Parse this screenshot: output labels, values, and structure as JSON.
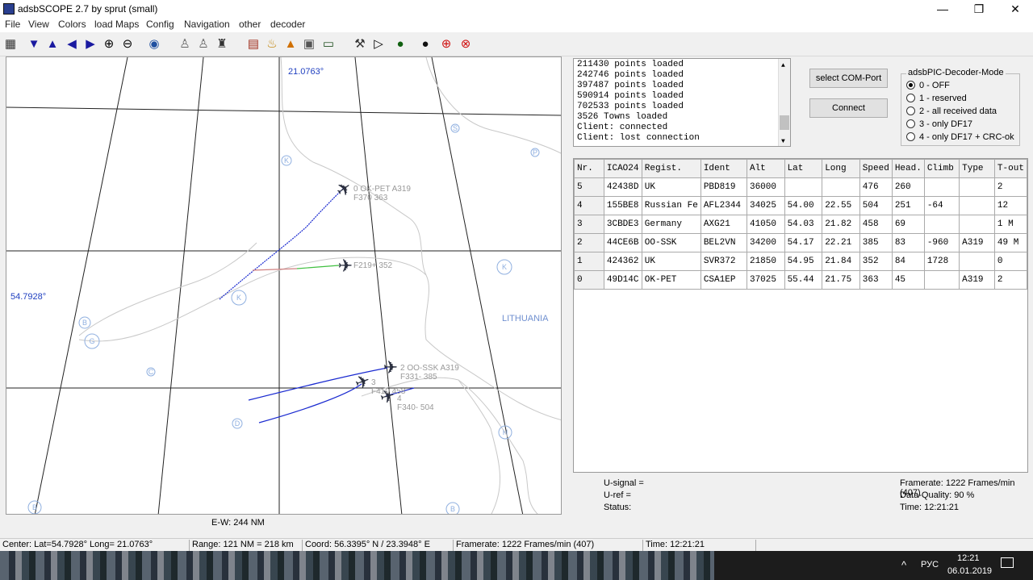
{
  "window": {
    "title": "adsbSCOPE 2.7 by sprut  (small)",
    "minimize": "—",
    "restore": "❐",
    "close": "✕"
  },
  "menu": [
    "File",
    "View",
    "Colors",
    "load Maps",
    "Config",
    "Navigation",
    "other",
    "decoder"
  ],
  "toolbar_icons": [
    "grid-icon",
    "arrow-down-icon",
    "arrow-up-icon",
    "arrow-left-icon",
    "arrow-right-icon",
    "zoom-in-icon",
    "zoom-out-icon",
    "globe-icon",
    "airports-icon",
    "navaids-icon",
    "towns-icon",
    "chart-icon",
    "weather-icon",
    "alert-icon",
    "photo-icon",
    "monitor-icon",
    "radar-dish-icon",
    "play-icon",
    "record-icon",
    "circle-icon",
    "target-icon",
    "crosshair-icon"
  ],
  "map": {
    "lon_label": "21.0763°",
    "lat_label": "54.7928°",
    "country_label": "LITHUANIA",
    "ew_range": "E-W: 244 NM",
    "aircraft": [
      {
        "line1": "0 OK-PET  A319",
        "line2": "F370   363"
      },
      {
        "line1": "",
        "line2": "F219+  352"
      },
      {
        "line1": "2 OO-SSK  A319",
        "line2": "F331-  385"
      },
      {
        "line1": "3",
        "line2": "F410  458"
      },
      {
        "line1": "4",
        "line2": "F340-  504"
      }
    ],
    "airport_markers": [
      "S",
      "K",
      "K",
      "K",
      "G",
      "B",
      "C",
      "D",
      "H",
      "B",
      "B",
      "P"
    ]
  },
  "log": [
    "211430 points loaded",
    "242746 points loaded",
    "397487 points loaded",
    "590914 points loaded",
    "702533 points loaded",
    "3526 Towns loaded",
    "Client: connected",
    "Client: lost connection"
  ],
  "buttons": {
    "com_port": "select COM-Port",
    "connect": "Connect"
  },
  "decoder": {
    "title": "adsbPIC-Decoder-Mode",
    "options": [
      "0 - OFF",
      "1 - reserved",
      "2 - all received data",
      "3 - only DF17",
      "4 - only DF17 + CRC-ok"
    ],
    "selected": 0
  },
  "table": {
    "headers": [
      "Nr.",
      "ICAO24",
      "Regist.",
      "Ident",
      "Alt",
      "Lat",
      "Long",
      "Speed",
      "Head.",
      "Climb",
      "Type",
      "T-out"
    ],
    "rows": [
      [
        "5",
        "42438D",
        "UK",
        "PBD819",
        "36000",
        "",
        "",
        "476",
        "260",
        "",
        "",
        "2"
      ],
      [
        "4",
        "155BE8",
        "Russian Fe",
        "AFL2344",
        "34025",
        "54.00",
        "22.55",
        "504",
        "251",
        "-64",
        "",
        "12"
      ],
      [
        "3",
        "3CBDE3",
        "Germany",
        "AXG21",
        "41050",
        "54.03",
        "21.82",
        "458",
        "69",
        "",
        "",
        "1 M"
      ],
      [
        "2",
        "44CE6B",
        "OO-SSK",
        "BEL2VN",
        "34200",
        "54.17",
        "22.21",
        "385",
        "83",
        "-960",
        "A319",
        "49 M"
      ],
      [
        "1",
        "424362",
        "UK",
        "SVR372",
        "21850",
        "54.95",
        "21.84",
        "352",
        "84",
        "1728",
        "",
        "0"
      ],
      [
        "0",
        "49D14C",
        "OK-PET",
        "CSA1EP",
        "37025",
        "55.44",
        "21.75",
        "363",
        "45",
        "",
        "A319",
        "2"
      ]
    ]
  },
  "signal": {
    "u_signal": "U-signal =",
    "u_ref": "U-ref =",
    "status": "Status:"
  },
  "stats": {
    "framerate": "Framerate:  1222 Frames/min (407)",
    "quality": "Data-Quality: 90 %",
    "time": "Time: 12:21:21"
  },
  "statusbar": {
    "center": "Center: Lat=54.7928° Long= 21.0763°",
    "range": "Range: 121 NM = 218 km",
    "coord": "Coord: 56.3395° N / 23.3948° E",
    "framerate": "Framerate:  1222 Frames/min (407)",
    "time": "Time: 12:21:21"
  },
  "tray": {
    "chevron": "^",
    "lang": "РУС",
    "clock": "12:21",
    "date": "06.01.2019"
  }
}
